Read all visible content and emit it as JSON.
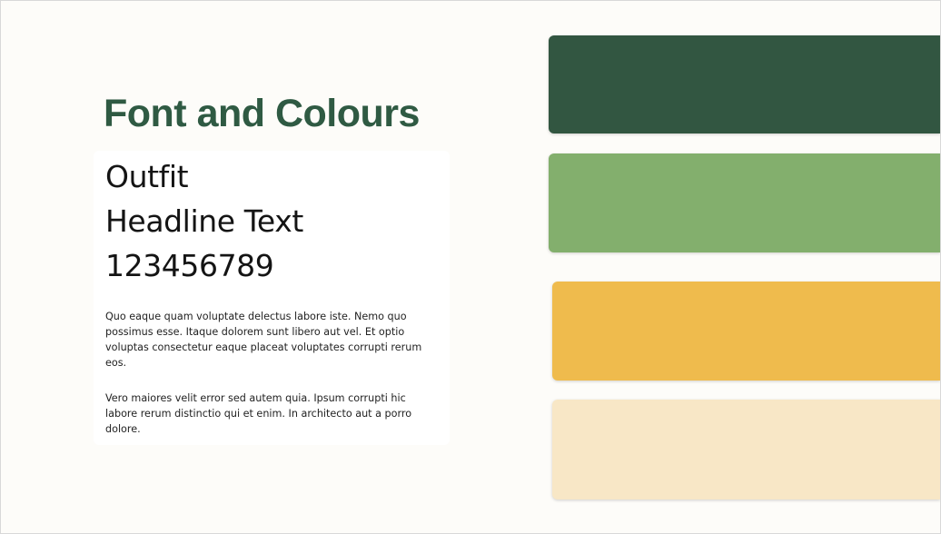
{
  "slide": {
    "title": "Font and Colours",
    "background_color": "#fdfcf9",
    "title_color": "#2f5a43"
  },
  "font_sample": {
    "lines": [
      "Outfit",
      "Headline Text",
      "123456789"
    ],
    "paragraphs": [
      "Quo eaque quam voluptate delectus labore iste. Nemo quo possimus esse. Itaque dolorem sunt libero aut vel. Et optio voluptas consectetur eaque placeat voluptates corrupti rerum eos.",
      "Vero maiores velit error sed autem quia. Ipsum corrupti hic labore rerum distinctio qui et enim. In architecto aut a porro dolore."
    ]
  },
  "palette": {
    "swatches": [
      {
        "color": "#325641"
      },
      {
        "color": "#83af6d"
      },
      {
        "color": "#efbb4d"
      },
      {
        "color": "#f8e7c6"
      }
    ]
  }
}
